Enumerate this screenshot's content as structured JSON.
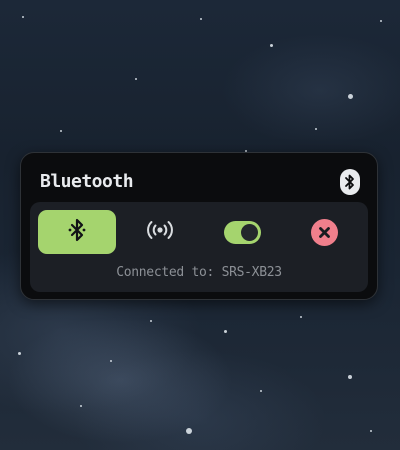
{
  "widget": {
    "title": "Bluetooth",
    "header_icon": "bluetooth-icon",
    "status_text": "Connected to: SRS-XB23",
    "controls": {
      "bluetooth_button": {
        "icon": "bluetooth-icon",
        "active": true
      },
      "broadcast_button": {
        "icon": "broadcast-icon"
      },
      "toggle": {
        "state": "on"
      },
      "close_button": {
        "icon": "close-icon"
      }
    },
    "colors": {
      "accent_green": "#a5d46e",
      "danger_pink": "#f07f8c",
      "widget_bg": "#0b0c0e",
      "panel_bg": "#1c1f25",
      "title_text": "#e9ebee",
      "muted_text": "#8c9096"
    }
  }
}
